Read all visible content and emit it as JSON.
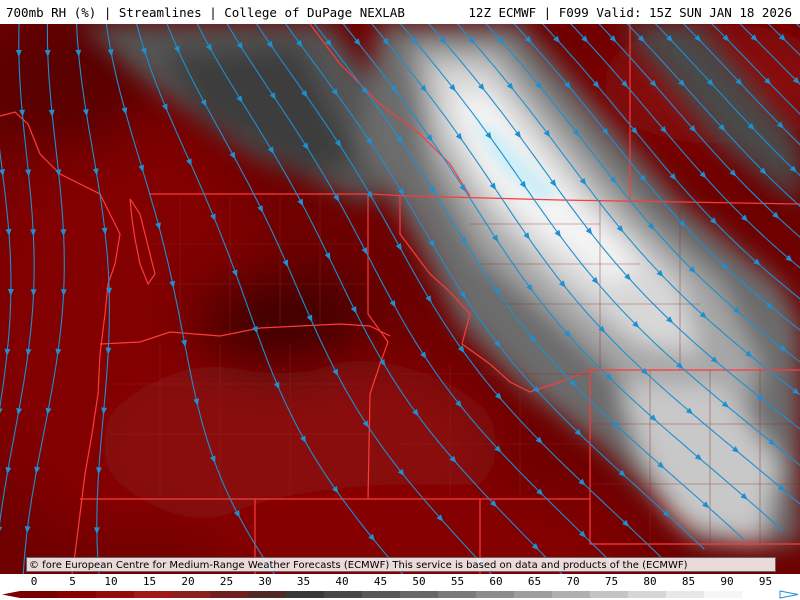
{
  "header": {
    "left_title": "700mb RH (%) | Streamlines | College of DuPage NEXLAB",
    "right_title": "12Z ECMWF | F099 Valid: 15Z SUN JAN 18 2026"
  },
  "credit": "© fore European Centre for Medium-Range Weather Forecasts (ECMWF) This service is based on data and products of the (ECMWF)",
  "legend": {
    "ticks": [
      "0",
      "5",
      "10",
      "15",
      "20",
      "25",
      "30",
      "35",
      "40",
      "45",
      "50",
      "55",
      "60",
      "65",
      "70",
      "75",
      "80",
      "85",
      "90",
      "95"
    ],
    "colors": [
      "#7a0000",
      "#880000",
      "#960a0a",
      "#a01818",
      "#8c2020",
      "#702020",
      "#502828",
      "#383838",
      "#484848",
      "#585858",
      "#686868",
      "#7a7a7a",
      "#8c8c8c",
      "#9e9e9e",
      "#b0b0b0",
      "#c4c4c4",
      "#d6d6d6",
      "#e8e8e8",
      "#f6f6f6",
      "#ffffff"
    ]
  },
  "colors": {
    "dry": "#6e0000",
    "streamline": "#1e8fd0",
    "border": "#ff3a3a",
    "county": "#8a2a2a",
    "moist_core": "#cfeef6"
  }
}
